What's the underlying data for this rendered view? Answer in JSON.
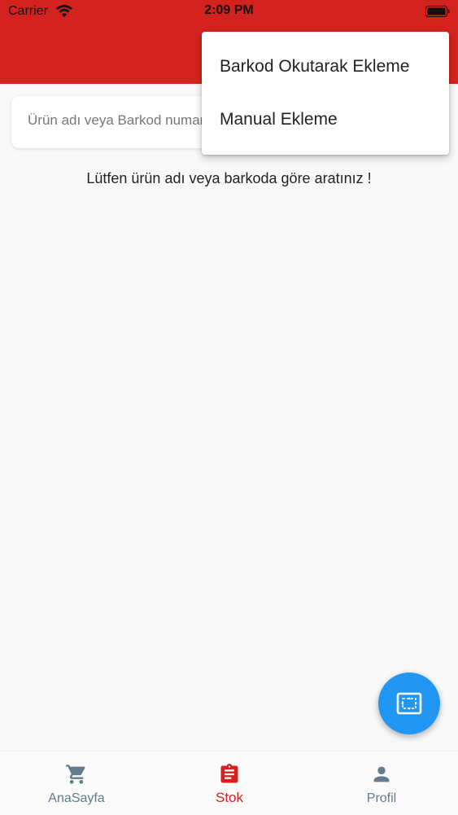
{
  "status_bar": {
    "carrier": "Carrier",
    "time": "2:09 PM"
  },
  "colors": {
    "primary": "#d4231e",
    "fab": "#2196f3",
    "nav_inactive": "#607d8b"
  },
  "search": {
    "placeholder": "Ürün adı veya Barkod numarası"
  },
  "empty_message": "Lütfen ürün adı veya barkoda göre aratınız !",
  "add_menu": {
    "items": [
      {
        "label": "Barkod Okutarak Ekleme"
      },
      {
        "label": "Manual Ekleme"
      }
    ]
  },
  "fab": {
    "icon": "scan-icon"
  },
  "bottom_nav": {
    "items": [
      {
        "label": "AnaSayfa",
        "icon": "cart-icon",
        "active": false
      },
      {
        "label": "Stok",
        "icon": "clipboard-icon",
        "active": true
      },
      {
        "label": "Profil",
        "icon": "person-icon",
        "active": false
      }
    ]
  }
}
